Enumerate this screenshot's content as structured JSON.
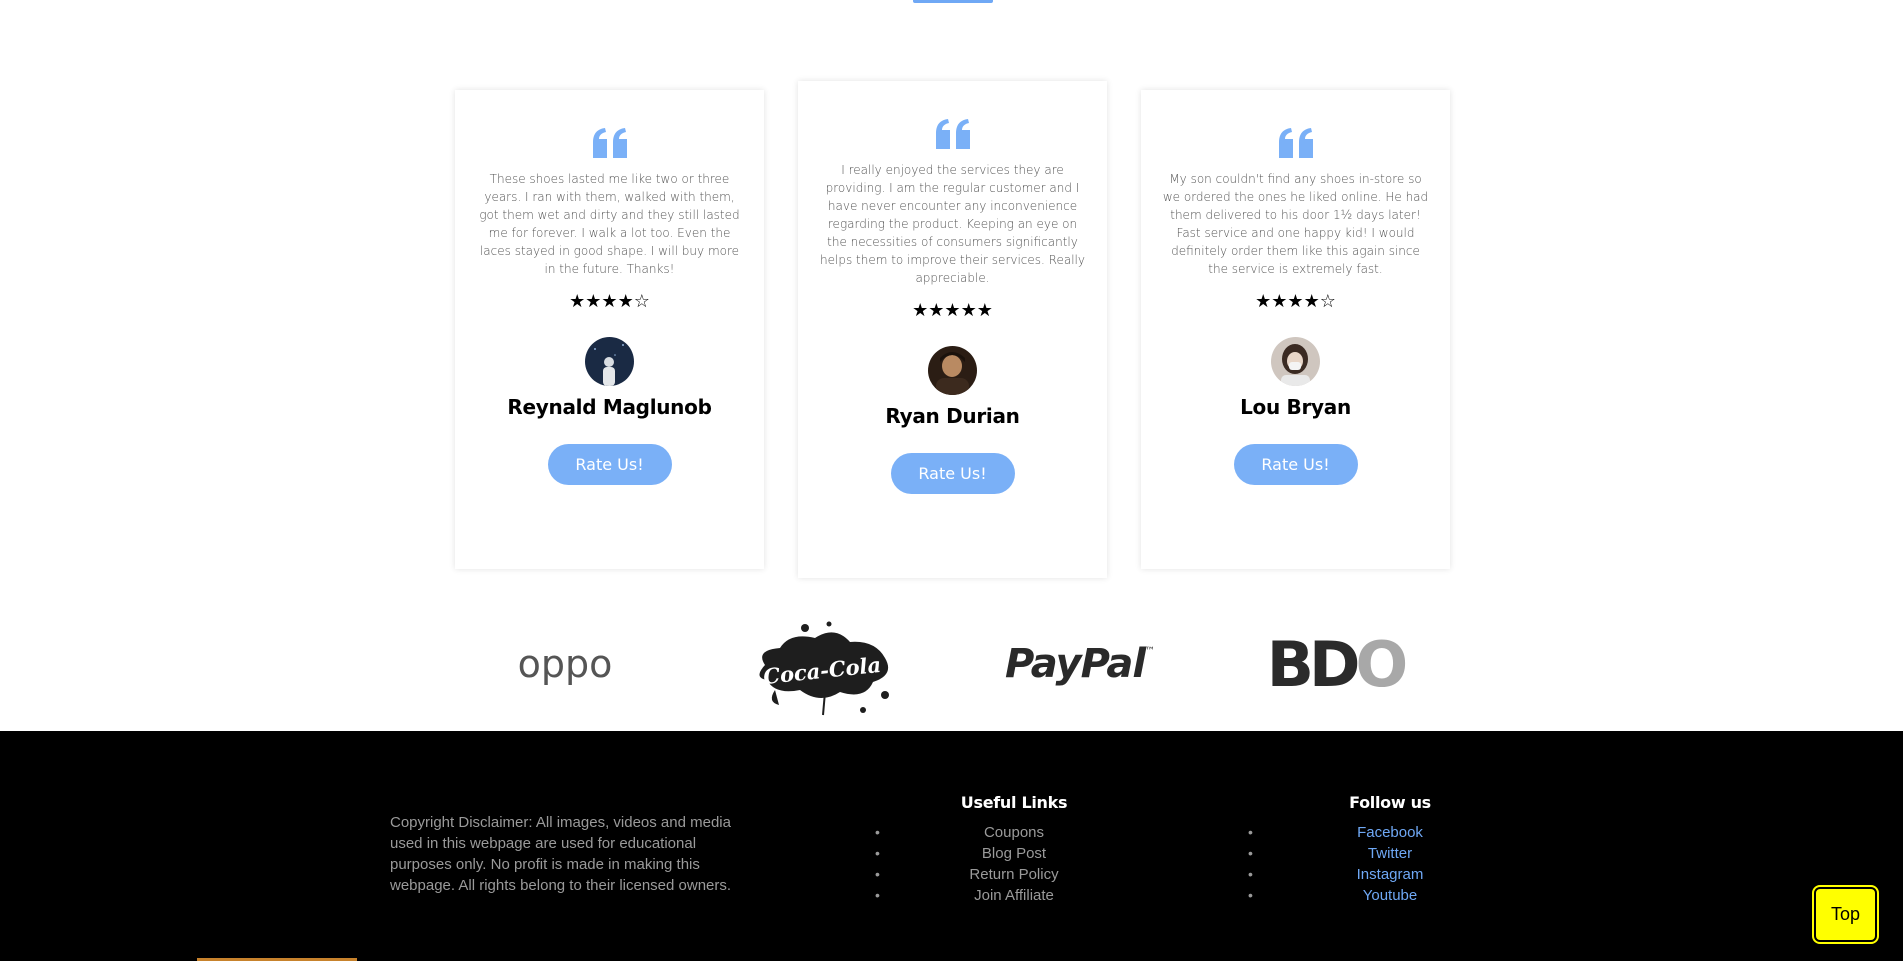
{
  "testimonials": [
    {
      "review": "These shoes lasted me like two or three years. I ran with them, walked with them, got them wet and dirty and they still lasted me for forever. I walk a lot too. Even the laces stayed in good shape. I will buy more in the future. Thanks!",
      "rating": 4,
      "stars_display": "★★★★☆",
      "name": "Reynald Maglunob",
      "button_label": "Rate Us!"
    },
    {
      "review": "I really enjoyed the services they are providing. I am the regular customer and I have never encounter any inconvenience regarding the product. Keeping an eye on the necessities of consumers significantly helps them to improve their services. Really appreciable.",
      "rating": 5,
      "stars_display": "★★★★★",
      "name": "Ryan Durian",
      "button_label": "Rate Us!"
    },
    {
      "review": "My son couldn't find any shoes in-store so we ordered the ones he liked online. He had them delivered to his door 1½ days later! Fast service and one happy kid! I would definitely order them like this again since the service is extremely fast.",
      "rating": 4,
      "stars_display": "★★★★☆",
      "name": "Lou Bryan",
      "button_label": "Rate Us!"
    }
  ],
  "partner_logos": {
    "oppo": "oppo",
    "coca_cola": "Coca-Cola",
    "paypal": "PayPal",
    "paypal_tm": "™",
    "bdo_bd": "BD",
    "bdo_o": "O"
  },
  "footer": {
    "disclaimer": "Copyright Disclaimer: All images, videos and media used in this webpage are used for educational purposes only. No profit is made in making this webpage. All rights belong to their licensed owners.",
    "useful_links": {
      "title": "Useful Links",
      "items": [
        "Coupons",
        "Blog Post",
        "Return Policy",
        "Join Affiliate"
      ]
    },
    "follow_us": {
      "title": "Follow us",
      "items": [
        "Facebook",
        "Twitter",
        "Instagram",
        "Youtube"
      ]
    }
  },
  "top_button": "Top",
  "colors": {
    "accent": "#7ab0f7",
    "link": "#6fa8f5",
    "footer_bg": "#000000",
    "top_button_bg": "#ffff00"
  }
}
